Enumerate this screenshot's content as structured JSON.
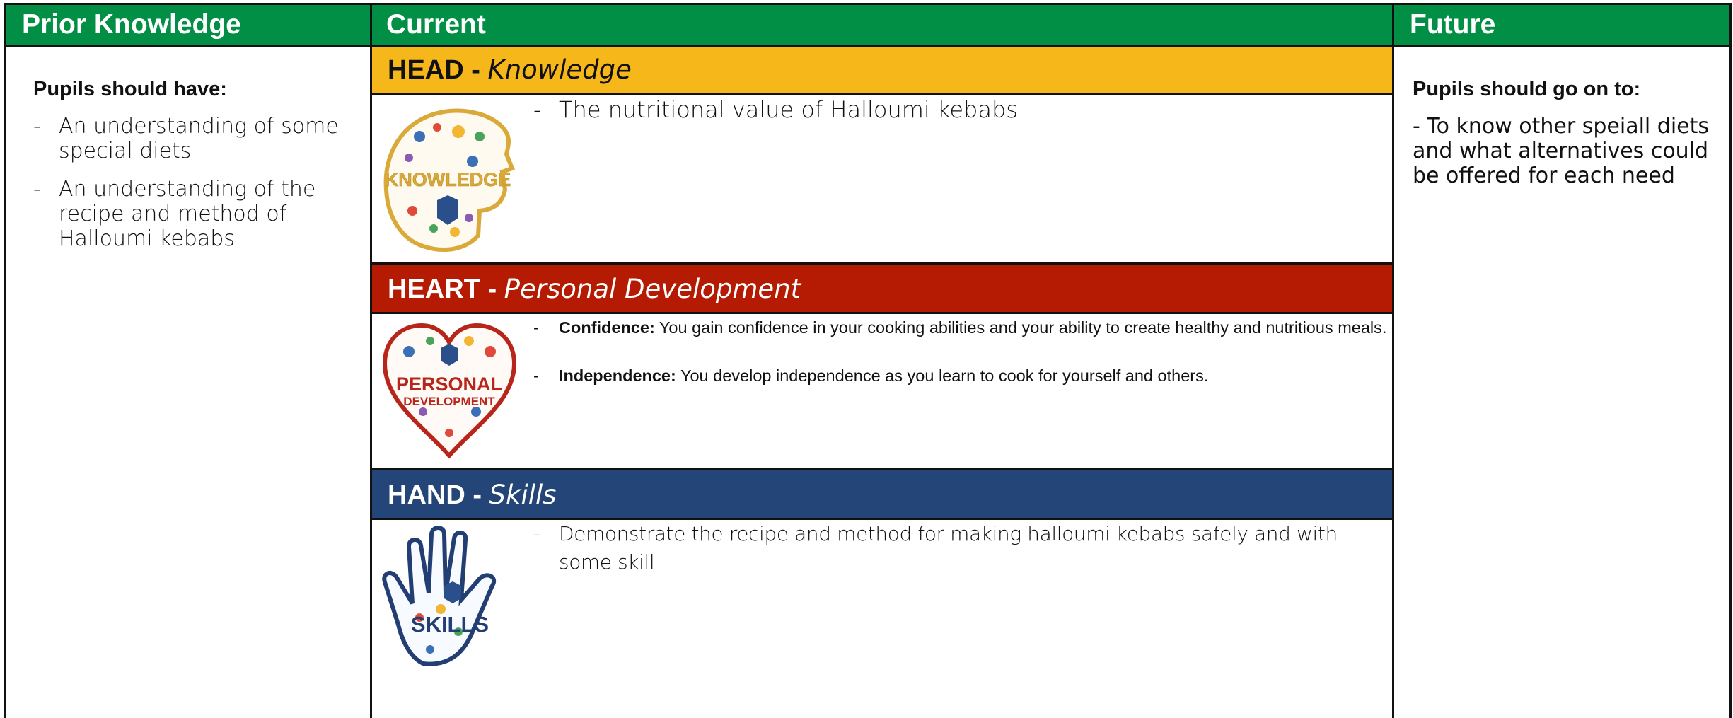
{
  "columns": {
    "prior": {
      "header": "Prior Knowledge",
      "title": "Pupils should have:",
      "items": [
        "An understanding of some special diets",
        "An understanding of the recipe and method of Halloumi kebabs"
      ]
    },
    "current": {
      "header": "Current",
      "head": {
        "label": "HEAD -",
        "subtitle": "Knowledge",
        "image_text": "KNOWLEDGE",
        "items": [
          "The nutritional value of Halloumi kebabs"
        ]
      },
      "heart": {
        "label": "HEART -",
        "subtitle": "Personal Development",
        "image_text_1": "PERSONAL",
        "image_text_2": "DEVELOPMENT",
        "items": [
          {
            "term": "Confidence:",
            "text": " You gain confidence in your cooking abilities and your ability to create healthy and nutritious meals."
          },
          {
            "term": "Independence:",
            "text": " You develop independence as you learn to cook for yourself and others."
          }
        ]
      },
      "hand": {
        "label": "HAND -",
        "subtitle": "Skills",
        "image_text": "SKILLS",
        "items": [
          "Demonstrate the recipe and method for making halloumi kebabs safely and with some skill"
        ]
      }
    },
    "future": {
      "header": "Future",
      "title": "Pupils should go on to:",
      "text": "- To know other speiall diets and what alternatives could be offered for each need"
    }
  },
  "colors": {
    "header_green": "#008f45",
    "head_yellow": "#f6b71a",
    "heart_red": "#b51b03",
    "hand_blue": "#234577"
  },
  "dash": "-"
}
